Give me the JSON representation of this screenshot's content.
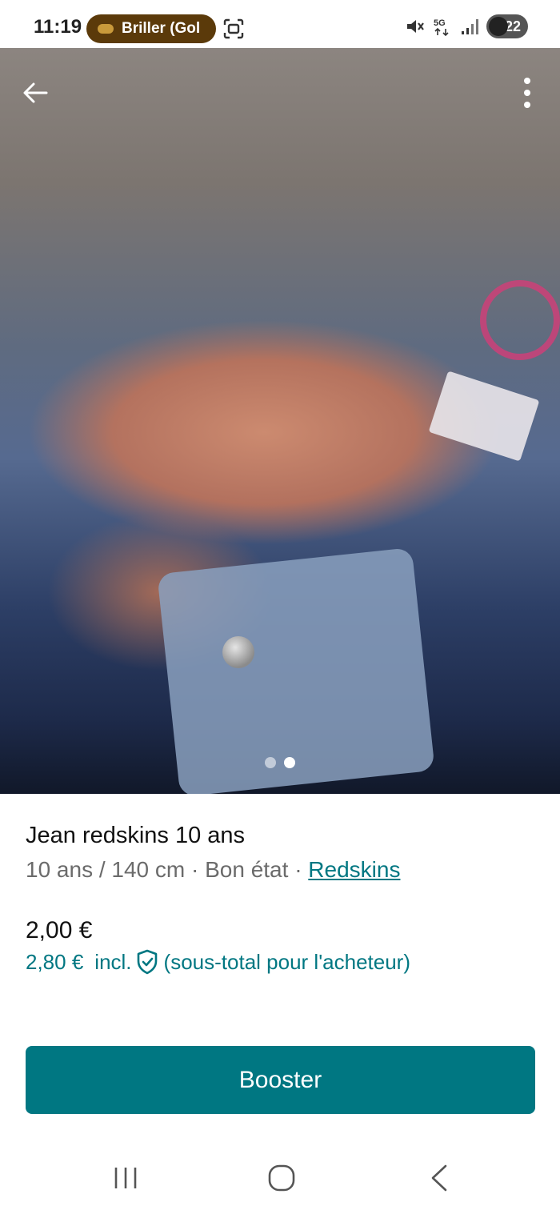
{
  "status_bar": {
    "time": "11:19",
    "notification_pill": "Briller (Gol",
    "network_label": "5G",
    "battery_level": "22"
  },
  "photo": {
    "page_indicator": {
      "count": 2,
      "active_index": 1
    },
    "icons": {
      "back": "arrow-left-icon",
      "menu": "more-vertical-icon"
    }
  },
  "item": {
    "title": "Jean redskins 10 ans",
    "details": "10 ans / 140 cm · Bon état · ",
    "brand": "Redskins",
    "price": "2,00 €",
    "buyer_price": "2,80 €",
    "buyer_incl": "incl.",
    "buyer_note": "(sous-total pour l'acheteur)"
  },
  "actions": {
    "booster_label": "Booster"
  },
  "colors": {
    "accent": "#007782",
    "text_secondary": "#6b6b6b"
  },
  "nav_bar": {
    "icons": [
      "recent-apps-icon",
      "home-icon",
      "back-icon"
    ]
  }
}
